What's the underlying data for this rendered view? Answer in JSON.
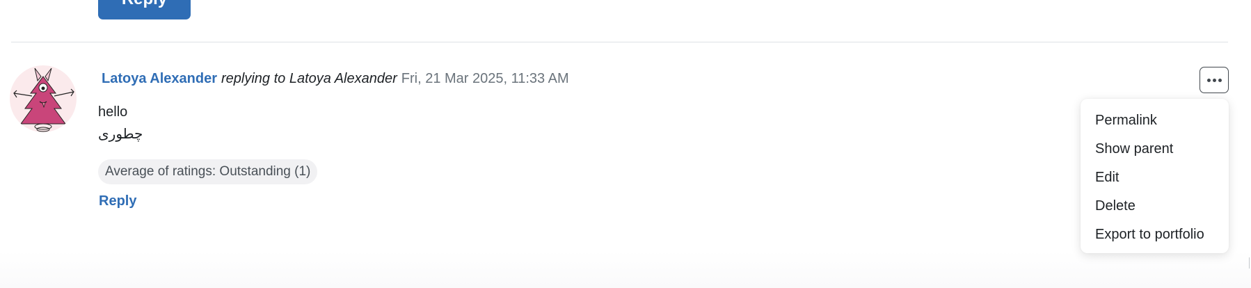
{
  "previous_post": {
    "reply_button_label": "Reply"
  },
  "post": {
    "author": "Latoya Alexander",
    "replying_to": "replying to Latoya Alexander",
    "date": "Fri, 21 Mar 2025, 11:33 AM",
    "body_lines": [
      "hello",
      "چطوری"
    ],
    "ratings": "Average of ratings: Outstanding (1)",
    "reply_label": "Reply",
    "more_actions_icon": "ellipsis-icon"
  },
  "actions_menu": {
    "items": [
      {
        "label": "Permalink"
      },
      {
        "label": "Show parent"
      },
      {
        "label": "Edit"
      },
      {
        "label": "Delete"
      },
      {
        "label": "Export to portfolio"
      }
    ]
  },
  "colors": {
    "link": "#2f6db5",
    "text": "#1d2125",
    "muted": "#6a737b",
    "pill_bg": "#f1f1f3",
    "avatar_bg": "#fbeaec",
    "avatar_figure": "#c9457a"
  }
}
